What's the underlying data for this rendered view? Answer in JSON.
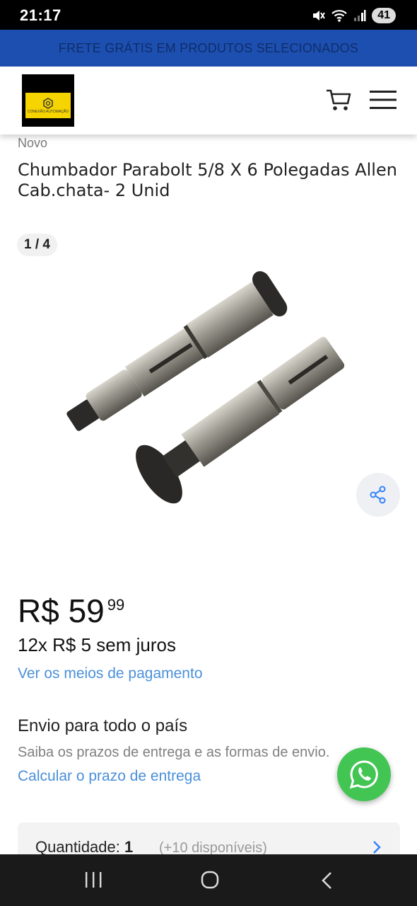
{
  "status_bar": {
    "time": "21:17",
    "battery": "41",
    "icons": [
      "mute-icon",
      "wifi-icon",
      "signal-icon",
      "battery-icon"
    ]
  },
  "promo": {
    "text": "FRETE GRÁTIS EM PRODUTOS SELECIONADOS"
  },
  "header": {
    "logo_text": "CONEXÃO AUTOMAÇÃO",
    "icons": [
      "cart-icon",
      "menu-icon"
    ]
  },
  "product": {
    "condition": "Novo",
    "title": "Chumbador Parabolt 5/8 X 6 Polegadas Allen Cab.chata- 2 Unid",
    "image_counter": "1 / 4",
    "price_main": "R$ 59",
    "price_cents": "99",
    "installments": "12x R$ 5 sem juros",
    "payment_link": "Ver os meios de pagamento"
  },
  "shipping": {
    "title": "Envio para todo o país",
    "description": "Saiba os prazos de entrega e as formas de envio.",
    "link": "Calcular o prazo de entrega"
  },
  "quantity": {
    "label": "Quantidade: ",
    "value": "1",
    "available": "(+10 disponíveis)"
  },
  "colors": {
    "promo_bg": "#1d4fb0",
    "link": "#4a90d9",
    "whatsapp": "#43c553",
    "logo_yellow": "#f5d400"
  }
}
